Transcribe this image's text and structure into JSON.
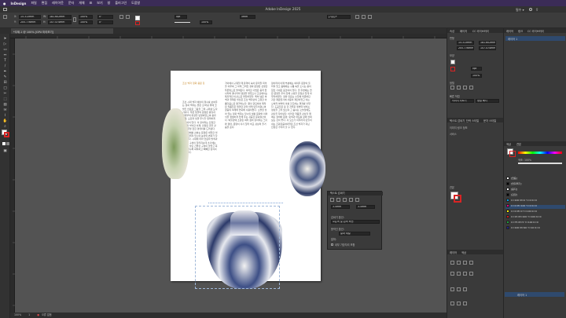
{
  "menubar": {
    "app_name": "InDesign",
    "items": [
      "파일",
      "편집",
      "레이아웃",
      "문자",
      "개체",
      "표",
      "보기",
      "창",
      "플러그인",
      "도움말"
    ],
    "clock": ""
  },
  "window": {
    "title": "Adobe InDesign 2025",
    "workspace": "필수 ▾",
    "document_tab": "*무제-1 @ 100% [GPU 미리보기]"
  },
  "control": {
    "x_label": "X:",
    "y_label": "Y:",
    "w_label": "W:",
    "h_label": "H:",
    "x_value": "15.313mm",
    "y_value": "205.776mm",
    "w_value": "181.602mm",
    "h_value": "107.474mm",
    "scale_x": "100%",
    "scale_y": "100%",
    "rotate": "0°",
    "shear": "0°",
    "stroke_weight": "0pt",
    "opacity": "100%",
    "size_value": "5mm",
    "style_select": "[기본]+"
  },
  "page": {
    "heading": "조선 백자 청화 용문 항아리",
    "columns": [
      "조선 시대 백자 예술의 정수를 보여주는 청화 백자는 맑은 흰 바탕 위에 코발트 안료로 그림을 그려 구워낸 도자기이다. 푸른 빛깔의 문양은 왕실과 사대부의 취향을 반영하였으며 용과 구름, 모란과 넝쿨 무늬가 유려하게 배치되어 있다. 이 항아리는 단정한 입술과 넉넉한 어깨, 안정된 굽을 갖추어 균형 잡힌 형태미를 드러낸다. 기면 전체를 감싸는 문양은 세밀한 필치로 그려져 있으며 농담의 변화가 자연스럽다. 시대에 따라 안료의 발색과 문양의 구성이 달라지는데 초기에는 여백을 살린 간결한 구성이 많았고 후기로 갈수록 화려하고 빽빽한 장식이 나타난다.",
      "가마에서 구워질 때 유약이 녹아 유리질 피막을 이루며 그 아래 그려진 청화 문양은 선명한 푸른빛으로 발색된다. 이러한 기법은 중국 원나라와 명나라의 영향을 받았으나 조선에서는 독자적인 미감으로 발전하였다. 특히 넓은 여백과 절제된 필선은 조선 백자만의 고유한 아름다움으로 평가받는다. 왕실 관요에서 제작된 작품들은 엄격한 관리 아래 만들어졌으며 궁중의 의례와 연회에 사용되었다. 오늘날 남아 있는 청화 백자는 당시의 생활 문화와 미의식을 생생하게 전해 주는 귀중한 문화유산이다. 박물관에 소장된 여러 점의 항아리는 크기와 형태, 문양이 각기 달라 비교 감상의 즐거움을 준다.",
      "항아리의 어깨 부분에는 여의두 문양이 둘러져 있고 몸체에는 구름 속을 노니는 용이 힘찬 기세로 표현되어 있다. 굽 주변에는 연판 문양을 두어 전체 구성을 안정감 있게 마무리하였다. 청화 안료는 수입에 의존하던 귀한 재료였기에 사용이 제한되었고 이는 오히려 여백의 미를 강조하는 결과를 낳았다. 도공들은 붓 한 자루로 생명력 넘치는 형상을 그려 냈으며 그 솜씨는 오늘날에도 감탄을 자아낸다. 이러한 작품을 감상할 때에는 형태와 문양, 유색과 태토를 함께 살펴보는 것이 좋다. 각 요소가 어우러져 만들어 내는 조화로움이야말로 조선 백자가 지닌 진정한 가치라 할 수 있다."
    ]
  },
  "float_panel": {
    "title": "텍스트 감싸기",
    "offset1": "3.5mm",
    "offset2": "3.5mm",
    "wrap_options_label": "감싸기 옵션:",
    "wrap_to": "오른쪽 및 왼쪽 측면",
    "contour_label": "윤곽선 옵션:",
    "contour_type": "알파 채널",
    "contour_alpha": "알파:",
    "include_edges": "내부 가장자리 포함"
  },
  "panel1": {
    "tabs": [
      "속성",
      "페이지",
      "CC 라이브러리"
    ],
    "sections": [
      "변형",
      "모양",
      "정렬",
      "빠른 작업"
    ],
    "tab2": [
      "텍스트 감싸기",
      "단락 스타일",
      "문자 스타일"
    ],
    "link_rows": [
      "이미지 링크 정보",
      "서비스"
    ],
    "swatch_title": "견본",
    "stroke_weight": "0pt",
    "tab3": [
      "레이어",
      "색상"
    ],
    "quick_actions": [
      "이미지 자르기",
      "정렬 배치"
    ]
  },
  "panel2": {
    "tabs": [
      "레이어",
      "링크",
      "CC 라이브러리"
    ],
    "layer_name": "레이어 1",
    "swatch_tabs": [
      "색상",
      "견본"
    ],
    "tint_label": "색조: 100%",
    "swatches": [
      {
        "name": "[없음]",
        "color": "#ffffff"
      },
      {
        "name": "[맞춰찍기]",
        "color": "#000000"
      },
      {
        "name": "[용지]",
        "color": "#ffffff"
      },
      {
        "name": "[검정]",
        "color": "#000000"
      },
      {
        "name": "C=100 M=0 Y=0 K=0",
        "color": "#00a0e9"
      },
      {
        "name": "C=0 M=100 Y=0 K=0",
        "color": "#e4007f"
      },
      {
        "name": "C=0 M=0 Y=100 K=0",
        "color": "#fff100"
      },
      {
        "name": "C=15 M=100 Y=100 K=0",
        "color": "#c9161d"
      },
      {
        "name": "C=75 M=5 Y=100 K=0",
        "color": "#1fa03c"
      },
      {
        "name": "C=100 M=90 Y=10 K=0",
        "color": "#1d2088"
      }
    ],
    "bottom_label": "레이어 1"
  },
  "status": {
    "zoom": "100%",
    "page_num": "1",
    "errors": "오류 없음"
  },
  "colors": {
    "menubar": "#3b2c57",
    "app_chrome": "#323232",
    "canvas": "#535353",
    "accent_stroke": "#d92424"
  }
}
